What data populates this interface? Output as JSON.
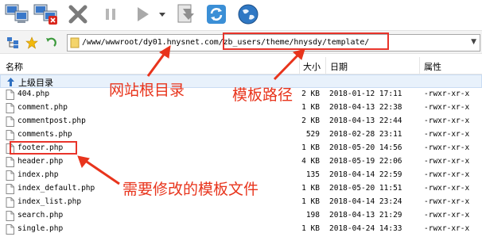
{
  "toolbar": {
    "buttons": [
      {
        "name": "connect-icon"
      },
      {
        "name": "disconnect-icon"
      },
      {
        "name": "cancel-icon"
      },
      {
        "name": "pause-icon"
      },
      {
        "name": "play-icon"
      },
      {
        "name": "play-dropdown-icon"
      },
      {
        "name": "queue-icon"
      },
      {
        "name": "refresh-icon"
      },
      {
        "name": "globe-icon"
      }
    ]
  },
  "address": {
    "path_prefix": "/www/wwwroot/dy01.hnysnet.com",
    "path_suffix": "/zb_users/theme/hnysdy/template/"
  },
  "columns": {
    "name": "名称",
    "size": "大小",
    "date": "日期",
    "perm": "属性"
  },
  "parent_label": "上级目录",
  "files": [
    {
      "name": "404.php",
      "size": "2 KB",
      "date": "2018-01-12 17:11",
      "perm": "-rwxr-xr-x"
    },
    {
      "name": "comment.php",
      "size": "1 KB",
      "date": "2018-04-13 22:38",
      "perm": "-rwxr-xr-x"
    },
    {
      "name": "commentpost.php",
      "size": "2 KB",
      "date": "2018-04-13 22:44",
      "perm": "-rwxr-xr-x"
    },
    {
      "name": "comments.php",
      "size": "529",
      "date": "2018-02-28 23:11",
      "perm": "-rwxr-xr-x"
    },
    {
      "name": "footer.php",
      "size": "1 KB",
      "date": "2018-05-20 14:56",
      "perm": "-rwxr-xr-x"
    },
    {
      "name": "header.php",
      "size": "4 KB",
      "date": "2018-05-19 22:06",
      "perm": "-rwxr-xr-x"
    },
    {
      "name": "index.php",
      "size": "135",
      "date": "2018-04-14 22:59",
      "perm": "-rwxr-xr-x"
    },
    {
      "name": "index_default.php",
      "size": "1 KB",
      "date": "2018-05-20 11:51",
      "perm": "-rwxr-xr-x"
    },
    {
      "name": "index_list.php",
      "size": "1 KB",
      "date": "2018-04-14 23:24",
      "perm": "-rwxr-xr-x"
    },
    {
      "name": "search.php",
      "size": "198",
      "date": "2018-04-13 21:29",
      "perm": "-rwxr-xr-x"
    },
    {
      "name": "single.php",
      "size": "1 KB",
      "date": "2018-04-24 14:33",
      "perm": "-rwxr-xr-x"
    }
  ],
  "annotations": {
    "root_dir": "网站根目录",
    "template_path": "模板路径",
    "edit_files": "需要修改的模板文件"
  },
  "colors": {
    "annotation": "#e8341c",
    "selection": "#e8f1fb"
  }
}
